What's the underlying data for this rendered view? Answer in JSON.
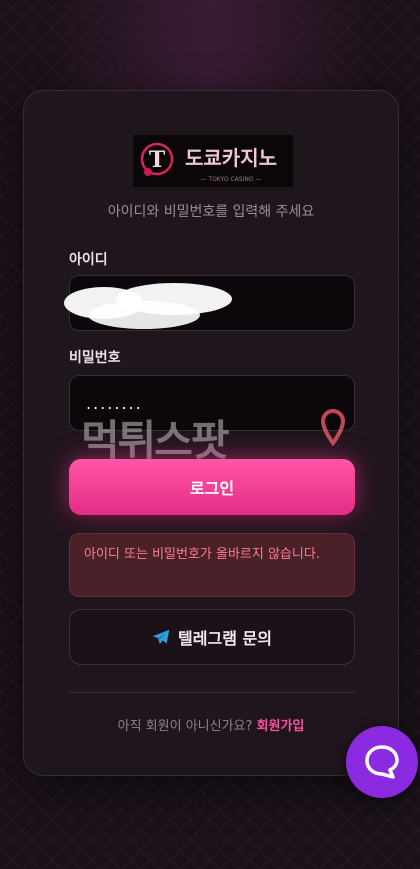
{
  "logo": {
    "text": "도쿄카지노",
    "sub_text": "— TOKYO CASINO —",
    "letter": "T"
  },
  "subtitle": "아이디와 비밀번호를 입력해 주세요",
  "form": {
    "id_label": "아이디",
    "password_label": "비밀번호",
    "password_value": "........"
  },
  "watermark": "먹튀스팟",
  "login_label": "로그인",
  "error_message": "아이디 또는 비밀번호가 올바르지 않습니다.",
  "telegram_label": "텔레그램 문의",
  "signup": {
    "prompt": "아직 회원이 아니신가요?",
    "link": "회원가입"
  },
  "colors": {
    "accent": "#ff4ea3",
    "error_text": "#ff7d8f",
    "chat_button": "#8a2be2",
    "telegram": "#2aa3e0"
  },
  "icons": {
    "telegram": "telegram-plane-icon",
    "chat": "chat-bubble-icon"
  }
}
